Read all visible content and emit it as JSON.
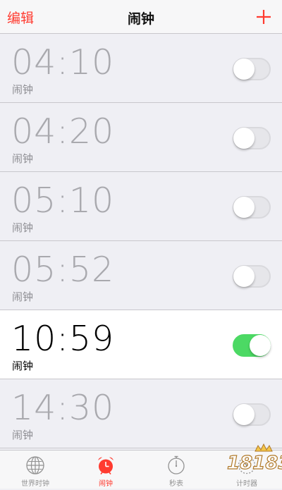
{
  "colors": {
    "accent": "#ff3b30",
    "toggle_on": "#4cd964",
    "list_bg": "#efeff4"
  },
  "navbar": {
    "edit_label": "编辑",
    "title": "闹钟",
    "add_icon": "plus-icon"
  },
  "alarms": [
    {
      "time": "04:10",
      "label": "闹钟",
      "enabled": false
    },
    {
      "time": "04:20",
      "label": "闹钟",
      "enabled": false
    },
    {
      "time": "05:10",
      "label": "闹钟",
      "enabled": false
    },
    {
      "time": "05:52",
      "label": "闹钟",
      "enabled": false
    },
    {
      "time": "10:59",
      "label": "闹钟",
      "enabled": true
    },
    {
      "time": "14:30",
      "label": "闹钟",
      "enabled": false
    }
  ],
  "tabbar": {
    "tabs": [
      {
        "label": "世界时钟",
        "icon": "globe-icon",
        "active": false
      },
      {
        "label": "闹钟",
        "icon": "alarm-clock-icon",
        "active": true
      },
      {
        "label": "秒表",
        "icon": "stopwatch-icon",
        "active": false
      },
      {
        "label": "计时器",
        "icon": "timer-icon",
        "active": false
      }
    ]
  },
  "watermark": {
    "text": "18183"
  }
}
